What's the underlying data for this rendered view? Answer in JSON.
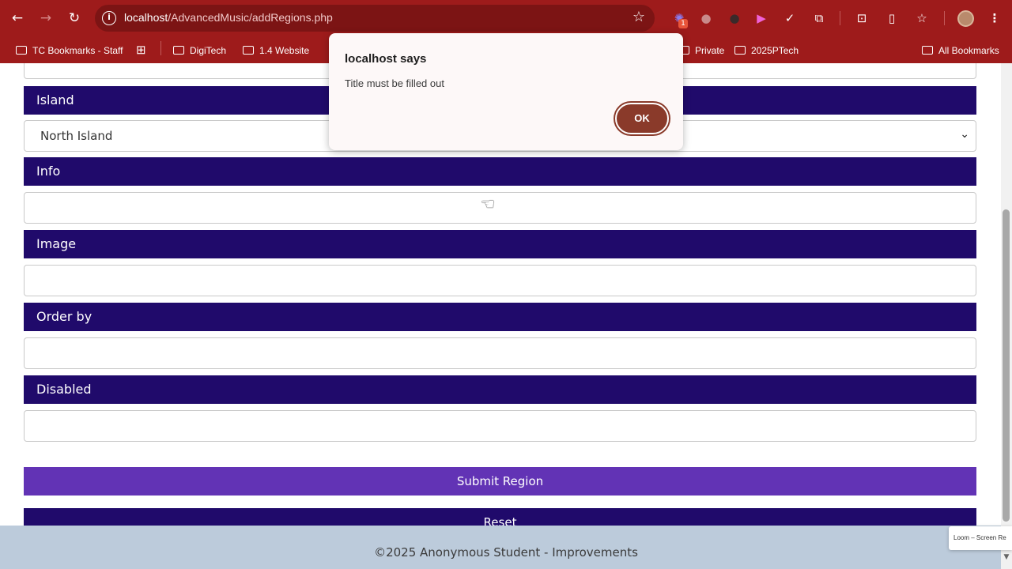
{
  "browser": {
    "url_host": "localhost",
    "url_path": "/AdvancedMusic/addRegions.php",
    "extension_badge": "1",
    "bookmarks": [
      {
        "label": "TC Bookmarks - Staff"
      },
      {
        "label": "DigiTech"
      },
      {
        "label": "1.4 Website"
      },
      {
        "label": "Private"
      },
      {
        "label": "2025PTech"
      },
      {
        "label": "All Bookmarks"
      }
    ]
  },
  "form": {
    "fields": [
      {
        "label": "Island",
        "type": "select",
        "value": "North Island"
      },
      {
        "label": "Info",
        "type": "text",
        "value": ""
      },
      {
        "label": "Image",
        "type": "text",
        "value": ""
      },
      {
        "label": "Order by",
        "type": "text",
        "value": ""
      },
      {
        "label": "Disabled",
        "type": "text",
        "value": ""
      }
    ],
    "submit_label": "Submit Region",
    "reset_label": "Reset"
  },
  "footer": {
    "text": "©2025 Anonymous Student - Improvements"
  },
  "dialog": {
    "title": "localhost says",
    "message": "Title must be filled out",
    "ok_label": "OK"
  },
  "loom": {
    "label": "Loom – Screen Re"
  },
  "colors": {
    "browser_chrome": "#9e1b1b",
    "label_bar": "#200a6b",
    "submit_button": "#6233b5",
    "footer": "#bccbdb",
    "ok_button": "#8a3a2a"
  }
}
